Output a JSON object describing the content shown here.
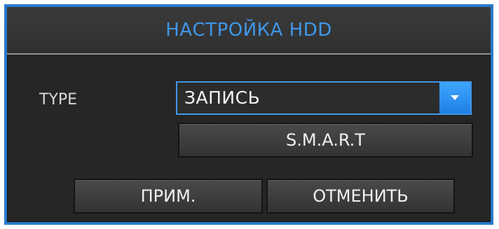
{
  "dialog": {
    "title": "НАСТРОЙКА HDD",
    "type_label": "TYPE",
    "type_select": {
      "value": "ЗАПИСЬ",
      "arrow_icon": "chevron-down-icon"
    },
    "smart_button": "S.M.A.R.T",
    "apply_button": "ПРИМ.",
    "cancel_button": "ОТМЕНИТЬ"
  },
  "colors": {
    "accent": "#3f97e8",
    "border": "#2a79c9",
    "background": "#262626"
  }
}
